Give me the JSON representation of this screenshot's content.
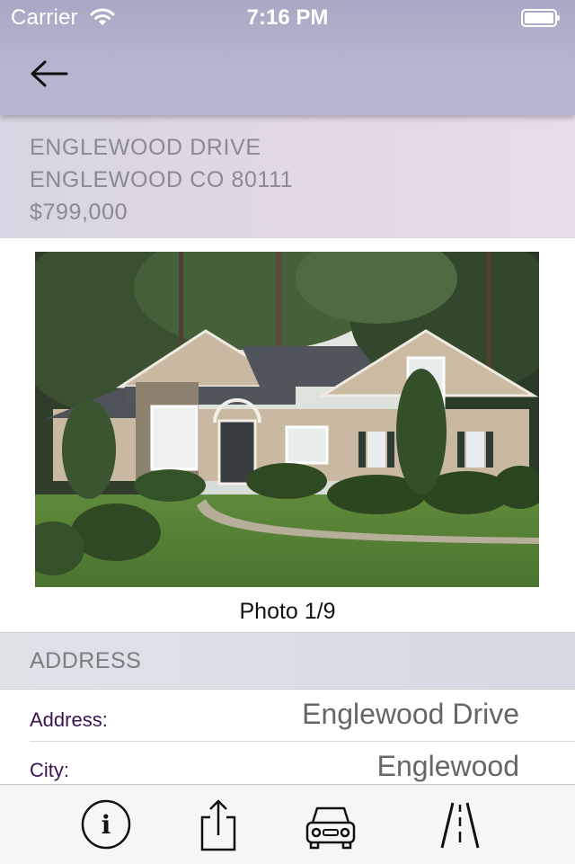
{
  "status_bar": {
    "carrier": "Carrier",
    "time": "7:16 PM"
  },
  "nav": {
    "back_icon": "arrow-left-icon"
  },
  "listing": {
    "street": "ENGLEWOOD DRIVE",
    "city_line": "ENGLEWOOD CO 80111",
    "price": "$799,000"
  },
  "photo": {
    "caption": "Photo 1/9"
  },
  "address_section": {
    "title": "ADDRESS",
    "rows": [
      {
        "label": "Address:",
        "value": "Englewood Drive"
      },
      {
        "label": "City:",
        "value": "Englewood"
      }
    ]
  },
  "tab_bar": {
    "icons": [
      "info-icon",
      "share-icon",
      "car-icon",
      "road-icon"
    ]
  },
  "colors": {
    "nav_bar": "#b4b6cf",
    "label_text": "#3a1552",
    "header_text": "#8a8a8f"
  }
}
